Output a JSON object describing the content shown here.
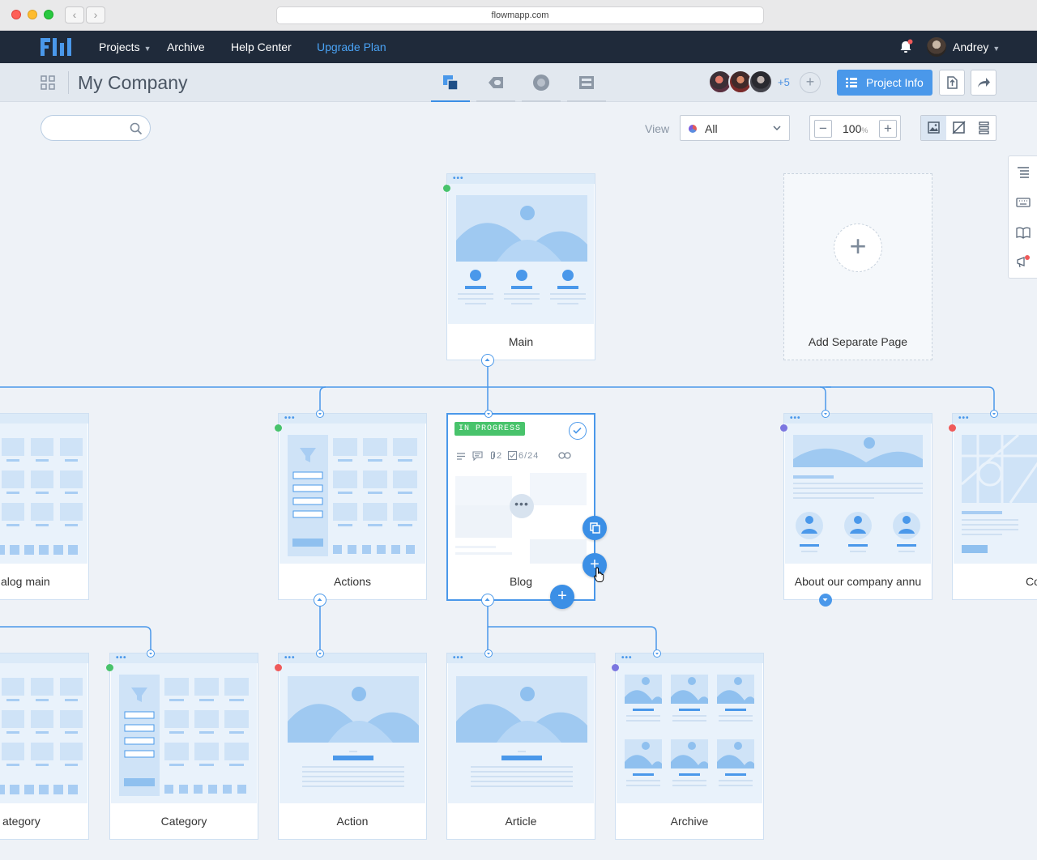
{
  "browser": {
    "url": "flowmapp.com"
  },
  "topnav": {
    "links": [
      {
        "label": "Projects",
        "dropdown": true
      },
      {
        "label": "Archive"
      },
      {
        "label": "Help Center"
      },
      {
        "label": "Upgrade Plan",
        "accent": "#4aa3f5"
      }
    ],
    "user_name": "Andrey"
  },
  "project": {
    "title": "My Company",
    "modes": [
      "sitemap-icon",
      "user-flow-icon",
      "personas-icon",
      "wireframes-icon"
    ],
    "active_mode": 0,
    "collaborators_more": "+5",
    "info_button": "Project Info"
  },
  "toolbar": {
    "search_placeholder": "",
    "view_label": "View",
    "view_value": "All",
    "zoom_value": "100",
    "zoom_unit": "%"
  },
  "canvas": {
    "pages": [
      {
        "label": "Main",
        "status": "#48c36b"
      },
      {
        "label": "alog main",
        "status": ""
      },
      {
        "label": "Actions",
        "status": "#48c36b"
      },
      {
        "label": "Blog",
        "status": "",
        "badge": "IN PROGRESS",
        "attachments": "2",
        "tasks": "6/24"
      },
      {
        "label": "About our company annu",
        "status": "#7b76e0"
      },
      {
        "label": "Conta",
        "status": "#ef5a5a"
      },
      {
        "label": "ategory",
        "status": ""
      },
      {
        "label": "Category",
        "status": "#48c36b"
      },
      {
        "label": "Action",
        "status": "#ef5a5a"
      },
      {
        "label": "Article",
        "status": ""
      },
      {
        "label": "Archive",
        "status": "#7b76e0"
      }
    ],
    "add_separate_page": "Add Separate Page"
  },
  "colors": {
    "accent": "#3b8fe6",
    "navbar": "#1f2a3a",
    "connector": "#4a98ea"
  }
}
